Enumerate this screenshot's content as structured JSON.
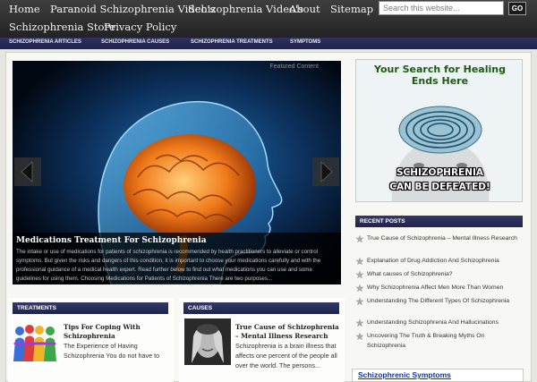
{
  "nav": {
    "items": [
      "Home",
      "Paranoid Schizophrenia Video's",
      "Schizophrenia Video's",
      "About",
      "Sitemap"
    ],
    "row2": [
      "Schizophrenia Store",
      "Privacy Policy"
    ],
    "search_placeholder": "Search this website...",
    "go_label": "GO"
  },
  "categories": [
    "SCHIZOPHRENIA ARTICLES",
    "SCHIZOPHRENIA CAUSES",
    "SCHIZOPHRENIA TREATMENTS",
    "SYMPTOMS"
  ],
  "featured": {
    "label": "Featured Content",
    "title": "Medications Treatment For Schizophrenia",
    "excerpt": "The intake or use of medications for patients of schizophrenia is recommended by health practitioners to alleviate or control symptoms. But given the risks and dangers of this condition, it is important to choose your medications carefully and with the professional guidance of a medical health expert. Read further below to find out what medications you can use and some guidelines for using them. Choosing Medications for Patients of Schizophrenia There are two purposes..."
  },
  "ad": {
    "headline_1": "Your Search for Healing",
    "headline_2": "Ends Here",
    "footer_1": "SCHIZOPHRENIA",
    "footer_2": "CAN BE DEFEATED!"
  },
  "recent_posts": {
    "title": "RECENT POSTS",
    "items": [
      "True Cause of Schizophrenia – Mental Illness Research",
      "Explanation of Drug Addiction And Schizophrenia",
      "What causes of Schizophrenia?",
      "Why Schizophrenia Affect Men More Than Women",
      "Understanding The Different Types Of Schizophrenia",
      "Understanding Schizophrenia And Hallucinations",
      "Uncovering The Truth & Breaking Myths On Schizophrenia"
    ]
  },
  "treatments": {
    "title": "TREATMENTS",
    "post_title": "Tips For Coping With Schizophrenia",
    "text": "The Experience of Having Schizophrenia You do not have to actually experience schizophrenia first-hand..."
  },
  "causes": {
    "title": "CAUSES",
    "post_title": "True Cause of Schizophrenia – Mental Illness Research",
    "text": "Schizophrenia is a brain illness that affects one percent of the people all over the world. The persons..."
  },
  "symptoms_box": {
    "link": "Schizophrenic Symptoms"
  },
  "colors": {
    "nav_bg": "#2b2b2b",
    "category_bar": "#262a55",
    "widget_header": "#2a2e5a",
    "page_bg": "#e6e6e1"
  }
}
